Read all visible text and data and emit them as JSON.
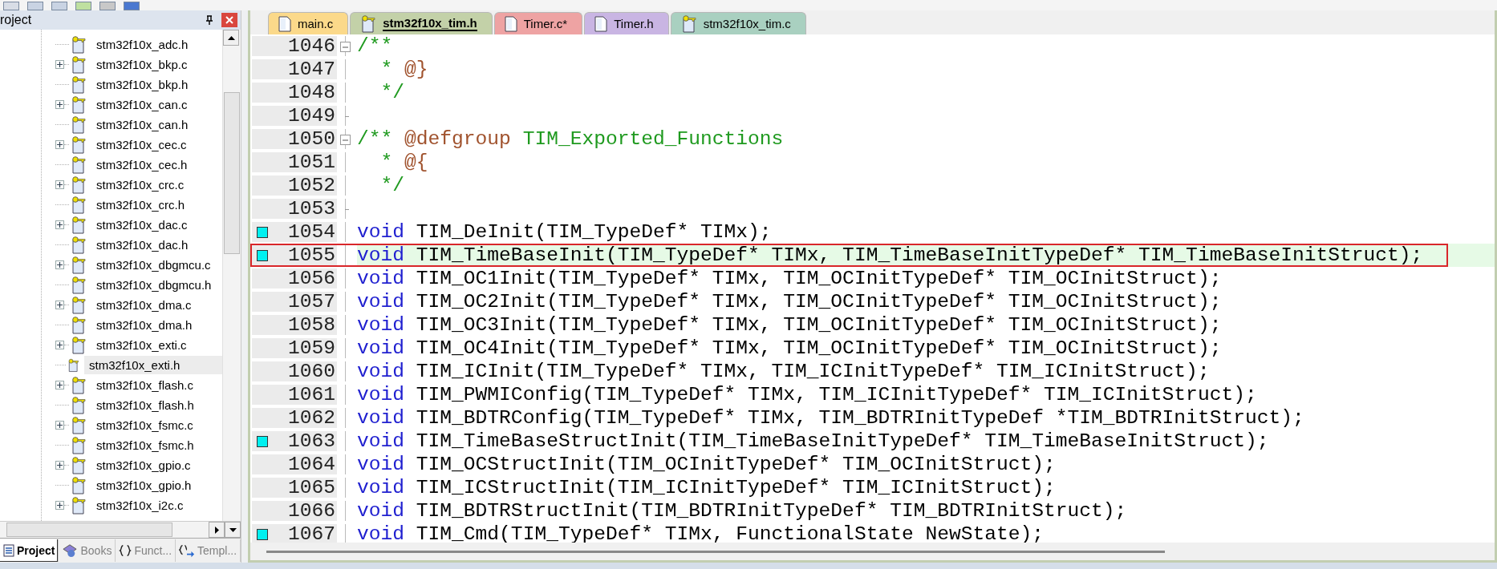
{
  "project_pane": {
    "title": "roject",
    "tree": [
      {
        "name": "stm32f10x_adc.h",
        "expandable": false,
        "selected": false
      },
      {
        "name": "stm32f10x_bkp.c",
        "expandable": true,
        "selected": false
      },
      {
        "name": "stm32f10x_bkp.h",
        "expandable": false,
        "selected": false
      },
      {
        "name": "stm32f10x_can.c",
        "expandable": true,
        "selected": false
      },
      {
        "name": "stm32f10x_can.h",
        "expandable": false,
        "selected": false
      },
      {
        "name": "stm32f10x_cec.c",
        "expandable": true,
        "selected": false
      },
      {
        "name": "stm32f10x_cec.h",
        "expandable": false,
        "selected": false
      },
      {
        "name": "stm32f10x_crc.c",
        "expandable": true,
        "selected": false
      },
      {
        "name": "stm32f10x_crc.h",
        "expandable": false,
        "selected": false
      },
      {
        "name": "stm32f10x_dac.c",
        "expandable": true,
        "selected": false
      },
      {
        "name": "stm32f10x_dac.h",
        "expandable": false,
        "selected": false
      },
      {
        "name": "stm32f10x_dbgmcu.c",
        "expandable": true,
        "selected": false
      },
      {
        "name": "stm32f10x_dbgmcu.h",
        "expandable": false,
        "selected": false
      },
      {
        "name": "stm32f10x_dma.c",
        "expandable": true,
        "selected": false
      },
      {
        "name": "stm32f10x_dma.h",
        "expandable": false,
        "selected": false
      },
      {
        "name": "stm32f10x_exti.c",
        "expandable": true,
        "selected": false
      },
      {
        "name": "stm32f10x_exti.h",
        "expandable": false,
        "selected": true
      },
      {
        "name": "stm32f10x_flash.c",
        "expandable": true,
        "selected": false
      },
      {
        "name": "stm32f10x_flash.h",
        "expandable": false,
        "selected": false
      },
      {
        "name": "stm32f10x_fsmc.c",
        "expandable": true,
        "selected": false
      },
      {
        "name": "stm32f10x_fsmc.h",
        "expandable": false,
        "selected": false
      },
      {
        "name": "stm32f10x_gpio.c",
        "expandable": true,
        "selected": false
      },
      {
        "name": "stm32f10x_gpio.h",
        "expandable": false,
        "selected": false
      },
      {
        "name": "stm32f10x_i2c.c",
        "expandable": true,
        "selected": false
      }
    ],
    "tabs": [
      {
        "label": "Project",
        "kind": "project",
        "selected": true
      },
      {
        "label": "Books",
        "kind": "books",
        "selected": false
      },
      {
        "label": "Funct...",
        "kind": "functions",
        "selected": false
      },
      {
        "label": "Templ...",
        "kind": "templates",
        "selected": false
      }
    ]
  },
  "editor": {
    "tabs": [
      {
        "label": "main.c",
        "kind": "plain",
        "color": "#fbd98a",
        "selected": false
      },
      {
        "label": "stm32f10x_tim.h",
        "kind": "library",
        "color": "#c3d1a8",
        "selected": true
      },
      {
        "label": "Timer.c*",
        "kind": "plain",
        "color": "#eea3a3",
        "selected": false
      },
      {
        "label": "Timer.h",
        "kind": "plain",
        "color": "#c9b5e3",
        "selected": false
      },
      {
        "label": "stm32f10x_tim.c",
        "kind": "library",
        "color": "#a9d0c0",
        "selected": false
      }
    ],
    "lines": [
      {
        "number": "1046",
        "bookmark": false,
        "fold_start": true,
        "fold_end": false,
        "current": false,
        "tokens": [
          {
            "kind": "comment",
            "text": "/**"
          }
        ]
      },
      {
        "number": "1047",
        "bookmark": false,
        "fold_start": false,
        "fold_end": false,
        "current": false,
        "tokens": [
          {
            "kind": "comment",
            "text": "  * "
          },
          {
            "kind": "doc",
            "text": "@}"
          }
        ]
      },
      {
        "number": "1048",
        "bookmark": false,
        "fold_start": false,
        "fold_end": false,
        "current": false,
        "tokens": [
          {
            "kind": "comment",
            "text": "  */"
          }
        ]
      },
      {
        "number": "1049",
        "bookmark": false,
        "fold_start": false,
        "fold_end": true,
        "current": false
      },
      {
        "number": "1050",
        "bookmark": false,
        "fold_start": true,
        "fold_end": false,
        "current": false,
        "tokens": [
          {
            "kind": "comment",
            "text": "/** "
          },
          {
            "kind": "doc",
            "text": "@defgroup"
          },
          {
            "kind": "comment",
            "text": " TIM_Exported_Functions"
          }
        ]
      },
      {
        "number": "1051",
        "bookmark": false,
        "fold_start": false,
        "fold_end": false,
        "current": false,
        "tokens": [
          {
            "kind": "comment",
            "text": "  * "
          },
          {
            "kind": "doc",
            "text": "@{"
          }
        ]
      },
      {
        "number": "1052",
        "bookmark": false,
        "fold_start": false,
        "fold_end": false,
        "current": false,
        "tokens": [
          {
            "kind": "comment",
            "text": "  */"
          }
        ]
      },
      {
        "number": "1053",
        "bookmark": false,
        "fold_start": false,
        "fold_end": true,
        "current": false
      },
      {
        "number": "1054",
        "bookmark": true,
        "fold_start": false,
        "fold_end": false,
        "current": false,
        "tokens": [
          {
            "kind": "keyword",
            "text": "void"
          },
          {
            "kind": "text",
            "text": " TIM_DeInit(TIM_TypeDef* TIMx);"
          }
        ]
      },
      {
        "number": "1055",
        "bookmark": true,
        "fold_start": false,
        "fold_end": false,
        "current": true,
        "tokens": [
          {
            "kind": "keyword",
            "text": "void"
          },
          {
            "kind": "text",
            "text": " TIM_TimeBaseInit(TIM_TypeDef* TIMx, TIM_TimeBaseInitTypeDef* TIM_TimeBaseInitStruct);"
          }
        ]
      },
      {
        "number": "1056",
        "bookmark": false,
        "fold_start": false,
        "fold_end": false,
        "current": false,
        "tokens": [
          {
            "kind": "keyword",
            "text": "void"
          },
          {
            "kind": "text",
            "text": " TIM_OC1Init(TIM_TypeDef* TIMx, TIM_OCInitTypeDef* TIM_OCInitStruct);"
          }
        ]
      },
      {
        "number": "1057",
        "bookmark": false,
        "fold_start": false,
        "fold_end": false,
        "current": false,
        "tokens": [
          {
            "kind": "keyword",
            "text": "void"
          },
          {
            "kind": "text",
            "text": " TIM_OC2Init(TIM_TypeDef* TIMx, TIM_OCInitTypeDef* TIM_OCInitStruct);"
          }
        ]
      },
      {
        "number": "1058",
        "bookmark": false,
        "fold_start": false,
        "fold_end": false,
        "current": false,
        "tokens": [
          {
            "kind": "keyword",
            "text": "void"
          },
          {
            "kind": "text",
            "text": " TIM_OC3Init(TIM_TypeDef* TIMx, TIM_OCInitTypeDef* TIM_OCInitStruct);"
          }
        ]
      },
      {
        "number": "1059",
        "bookmark": false,
        "fold_start": false,
        "fold_end": false,
        "current": false,
        "tokens": [
          {
            "kind": "keyword",
            "text": "void"
          },
          {
            "kind": "text",
            "text": " TIM_OC4Init(TIM_TypeDef* TIMx, TIM_OCInitTypeDef* TIM_OCInitStruct);"
          }
        ]
      },
      {
        "number": "1060",
        "bookmark": false,
        "fold_start": false,
        "fold_end": false,
        "current": false,
        "tokens": [
          {
            "kind": "keyword",
            "text": "void"
          },
          {
            "kind": "text",
            "text": " TIM_ICInit(TIM_TypeDef* TIMx, TIM_ICInitTypeDef* TIM_ICInitStruct);"
          }
        ]
      },
      {
        "number": "1061",
        "bookmark": false,
        "fold_start": false,
        "fold_end": false,
        "current": false,
        "tokens": [
          {
            "kind": "keyword",
            "text": "void"
          },
          {
            "kind": "text",
            "text": " TIM_PWMIConfig(TIM_TypeDef* TIMx, TIM_ICInitTypeDef* TIM_ICInitStruct);"
          }
        ]
      },
      {
        "number": "1062",
        "bookmark": false,
        "fold_start": false,
        "fold_end": false,
        "current": false,
        "tokens": [
          {
            "kind": "keyword",
            "text": "void"
          },
          {
            "kind": "text",
            "text": " TIM_BDTRConfig(TIM_TypeDef* TIMx, TIM_BDTRInitTypeDef *TIM_BDTRInitStruct);"
          }
        ]
      },
      {
        "number": "1063",
        "bookmark": true,
        "fold_start": false,
        "fold_end": false,
        "current": false,
        "tokens": [
          {
            "kind": "keyword",
            "text": "void"
          },
          {
            "kind": "text",
            "text": " TIM_TimeBaseStructInit(TIM_TimeBaseInitTypeDef* TIM_TimeBaseInitStruct);"
          }
        ]
      },
      {
        "number": "1064",
        "bookmark": false,
        "fold_start": false,
        "fold_end": false,
        "current": false,
        "tokens": [
          {
            "kind": "keyword",
            "text": "void"
          },
          {
            "kind": "text",
            "text": " TIM_OCStructInit(TIM_OCInitTypeDef* TIM_OCInitStruct);"
          }
        ]
      },
      {
        "number": "1065",
        "bookmark": false,
        "fold_start": false,
        "fold_end": false,
        "current": false,
        "tokens": [
          {
            "kind": "keyword",
            "text": "void"
          },
          {
            "kind": "text",
            "text": " TIM_ICStructInit(TIM_ICInitTypeDef* TIM_ICInitStruct);"
          }
        ]
      },
      {
        "number": "1066",
        "bookmark": false,
        "fold_start": false,
        "fold_end": false,
        "current": false,
        "tokens": [
          {
            "kind": "keyword",
            "text": "void"
          },
          {
            "kind": "text",
            "text": " TIM_BDTRStructInit(TIM_BDTRInitTypeDef* TIM_BDTRInitStruct);"
          }
        ]
      },
      {
        "number": "1067",
        "bookmark": true,
        "fold_start": false,
        "fold_end": false,
        "current": false,
        "tokens": [
          {
            "kind": "keyword",
            "text": "void"
          },
          {
            "kind": "text",
            "text": " TIM_Cmd(TIM_TypeDef* TIMx, FunctionalState NewState);"
          }
        ]
      }
    ]
  }
}
